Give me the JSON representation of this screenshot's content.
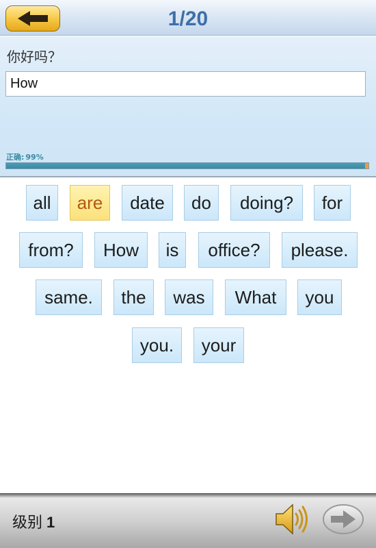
{
  "header": {
    "back_icon": "arrow-left-icon",
    "counter": "1/20"
  },
  "question": {
    "prompt": "你好吗？",
    "answer_value": "How",
    "accuracy_label": "正确:",
    "accuracy_value": "99%",
    "progress_fraction": 0.99
  },
  "words": [
    {
      "text": "all",
      "selected": false
    },
    {
      "text": "are",
      "selected": true
    },
    {
      "text": "date",
      "selected": false
    },
    {
      "text": "do",
      "selected": false
    },
    {
      "text": "doing?",
      "selected": false
    },
    {
      "text": "for",
      "selected": false
    },
    {
      "text": "from?",
      "selected": false
    },
    {
      "text": "How",
      "selected": false
    },
    {
      "text": "is",
      "selected": false
    },
    {
      "text": "office?",
      "selected": false
    },
    {
      "text": "please.",
      "selected": false
    },
    {
      "text": "same.",
      "selected": false
    },
    {
      "text": "the",
      "selected": false
    },
    {
      "text": "was",
      "selected": false
    },
    {
      "text": "What",
      "selected": false
    },
    {
      "text": "you",
      "selected": false
    },
    {
      "text": "you.",
      "selected": false
    },
    {
      "text": "your",
      "selected": false
    }
  ],
  "footer": {
    "level_label": "级别",
    "level_value": "1",
    "sound_icon": "speaker-icon",
    "next_icon": "arrow-right-icon"
  },
  "colors": {
    "counter": "#3e6fa8",
    "tile_bg": "#cbe7fa",
    "tile_selected_bg": "#fbe17c",
    "tile_selected_text": "#b2590f",
    "progress_fill": "#3a8aa4",
    "progress_remainder": "#f39a3c"
  }
}
